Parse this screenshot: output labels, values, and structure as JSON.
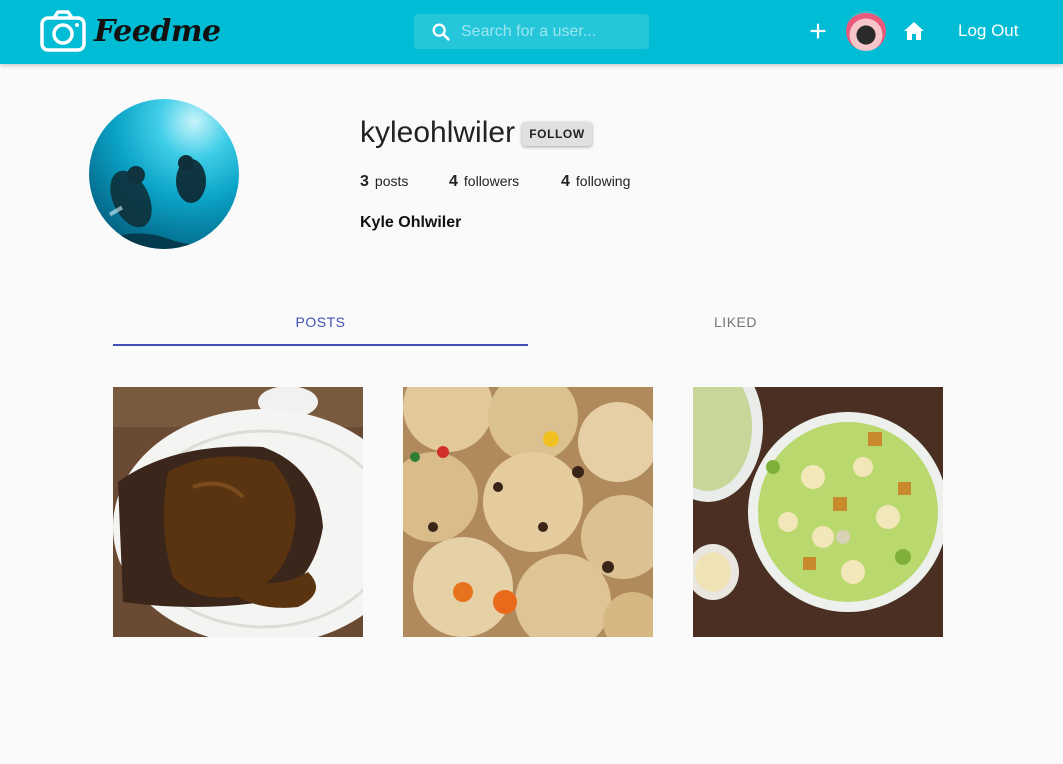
{
  "app": {
    "logo_text": "Feedme",
    "search_placeholder": "Search for a user...",
    "logout_label": "Log Out",
    "brand_color": "#00bcd4"
  },
  "nav": {
    "add_icon": "plus-icon",
    "home_icon": "home-icon",
    "search_icon": "search-icon"
  },
  "profile": {
    "username": "kyleohlwiler",
    "follow_label": "FOLLOW",
    "full_name": "Kyle Ohlwiler",
    "stats": [
      {
        "count": "3",
        "label": "posts"
      },
      {
        "count": "4",
        "label": "followers"
      },
      {
        "count": "4",
        "label": "following"
      }
    ]
  },
  "tabs": [
    {
      "label": "POSTS",
      "active": true
    },
    {
      "label": "LIKED",
      "active": false
    }
  ],
  "accent_color": "#3f51b5",
  "posts": [
    {
      "subject": "steak with gravy"
    },
    {
      "subject": "chocolate chip cookies"
    },
    {
      "subject": "caesar pasta salad"
    }
  ]
}
